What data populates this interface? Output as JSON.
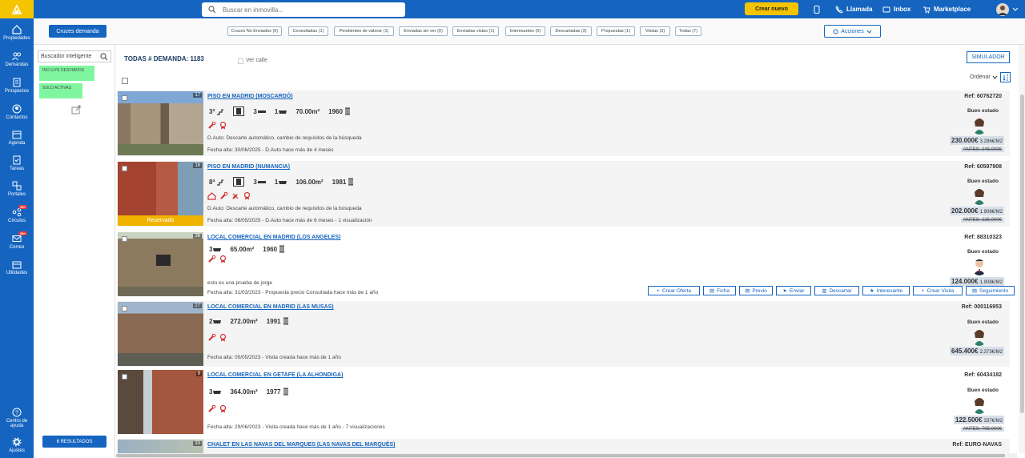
{
  "topbar": {
    "search_placeholder": "Buscar en inmovilla...",
    "create_label": "Crear nuevo",
    "nav": [
      "Llamada",
      "Inbox",
      "Marketplace"
    ]
  },
  "sidebar": {
    "items": [
      "Propiedades",
      "Demandas",
      "Prospectos",
      "Contactos",
      "Agenda",
      "Tareas",
      "Portales",
      "Círculos",
      "Correo",
      "Utilidades"
    ],
    "badges": {
      "circulos": "99+",
      "correo": "99+"
    },
    "bottom": [
      "Centro de ayuda",
      "Ajustes"
    ]
  },
  "filters": {
    "cruces_label": "Cruces demanda",
    "chips": [
      "Cruces No Enviados (0)",
      "Consultadas (1)",
      "Pendientes de valorar (1)",
      "Enviadas sin ver (0)",
      "Enviadas vistas (1)",
      "Interesantes (0)",
      "Descartadas (3)",
      "Propuestas (1)",
      "Visitas (3)",
      "Todas (7)"
    ],
    "acciones_label": "Acciones"
  },
  "left": {
    "smart_search": "Buscador inteligente",
    "tags": [
      "INCLUYE DESVIADOS",
      "SOLO ACTIVAS"
    ],
    "results": "6 RESULTADOS"
  },
  "header": {
    "title": "TODAS # DEMANDA: 1183",
    "ver_calle": "Ver calle",
    "simulador": "SIMULADOR",
    "ordenar": "Ordenar"
  },
  "listings": [
    {
      "title": "PISO EN MADRID (MOSCARDÓ)",
      "photos": "17",
      "feats": [
        "3ª",
        "",
        "3",
        "1",
        "70.00m²",
        "1960"
      ],
      "desc1": "D.Auto: Descarte automático, cambio de requisitos de la búsqueda",
      "desc2": "Fecha alta: 30/06/2025 - D.Auto hace más de 4 meses",
      "ref": "Ref: 60762720",
      "estado": "Buen estado",
      "price": "230.000€",
      "ppm": "3.286€/M2",
      "old": "ANTES: 245.000€"
    },
    {
      "title": "PISO EN MADRID (NUMANCIA)",
      "photos": "16",
      "reserved": "Reservado",
      "feats": [
        "8ª",
        "",
        "3",
        "1",
        "106.00m²",
        "1981"
      ],
      "desc1": "D.Auto: Descarte automático, cambio de requisitos de la búsqueda",
      "desc2": "Fecha alta: 08/05/2025 - D.Auto hace más de 6 meses - 1 visualización",
      "ref": "Ref: 60597908",
      "estado": "Buen estado",
      "price": "202.000€",
      "ppm": "1.906€/M2",
      "old": "ANTES: 225.000€"
    },
    {
      "title": "LOCAL COMERCIAL EN MADRID (LOS ANGELES)",
      "photos": "36",
      "feats": [
        "3",
        "65.00m²",
        "1960"
      ],
      "desc1": "esto es una prueba de jorge",
      "desc2": "Fecha alta: 31/03/2023 - Propuesta precio Consultada hace más de 1 año",
      "ref": "Ref: 88310323",
      "estado": "Buen estado",
      "price": "124.000€",
      "ppm": "1.908€/M2",
      "actions": [
        "Crear Oferta",
        "Ficha",
        "Previo",
        "Enviar",
        "Descartar",
        "Interesante",
        "Crear Visita",
        "Seguimiento"
      ]
    },
    {
      "title": "LOCAL COMERCIAL EN MADRID (LAS MUSAS)",
      "photos": "27",
      "feats": [
        "2",
        "272.00m²",
        "1991"
      ],
      "desc2": "Fecha alta: 05/05/2023 - Visita creada hace más de 1 año",
      "ref": "Ref: 000116953",
      "estado": "Buen estado",
      "price": "645.400€",
      "ppm": "2.373€/M2"
    },
    {
      "title": "LOCAL COMERCIAL EN GETAFE (LA ALHONDIGA)",
      "photos": "9",
      "feats": [
        "3",
        "364.00m²",
        "1977"
      ],
      "desc2": "Fecha alta: 29/06/2023 - Visita creada hace más de 1 año - 7 visualizaciones",
      "ref": "Ref: 60434182",
      "estado": "Buen estado",
      "price": "122.500€",
      "ppm": "337€/M2",
      "old": "ANTES: 795.000€"
    },
    {
      "title": "CHALET EN LAS NAVAS DEL MARQUES (LAS NAVAS DEL MARQUÉS)",
      "photos": "33",
      "ref": "Ref: EURO-NAVAS"
    }
  ]
}
